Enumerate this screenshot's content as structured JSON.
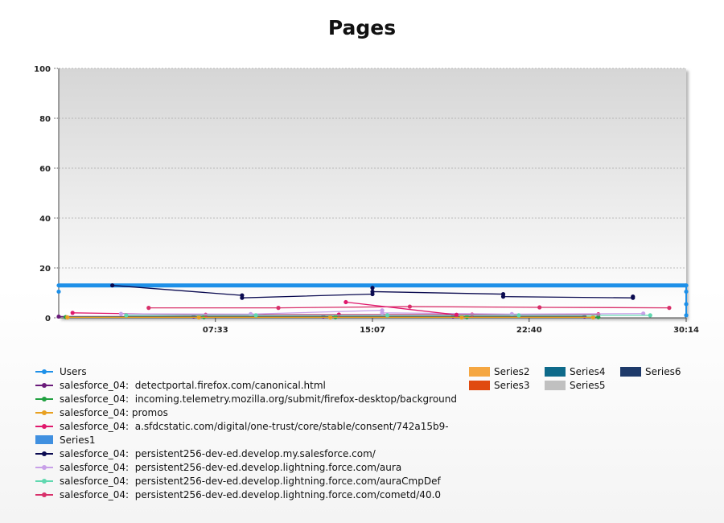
{
  "chart_data": {
    "type": "line",
    "title": "Pages",
    "xlabel": "",
    "ylabel": "",
    "ylim": [
      0,
      100
    ],
    "xlim": [
      "00:00",
      "30:14"
    ],
    "yticks": [
      "0",
      "20",
      "40",
      "60",
      "80",
      "100"
    ],
    "xticks": [
      "07:33",
      "15:07",
      "22:40",
      "30:14"
    ],
    "grid": true,
    "legend_position": "bottom",
    "series": [
      {
        "name": "Users",
        "color": "#1e90e8",
        "marker": "circle",
        "x": [
          "00:00",
          "00:00",
          "30:14",
          "30:14",
          "30:14",
          "30:14"
        ],
        "y": [
          13,
          10.5,
          13,
          10.5,
          5.5,
          1
        ]
      },
      {
        "name": "salesforce_04:  detectportal.firefox.com/canonical.html",
        "color": "#6a1b7a",
        "marker": "circle",
        "x": [
          "00:00",
          "06:30",
          "12:45",
          "19:00",
          "25:20"
        ],
        "y": [
          0.5,
          0.5,
          0.5,
          0.5,
          0.5
        ]
      },
      {
        "name": "salesforce_04:  incoming.telemetry.mozilla.org/submit/firefox-desktop/background",
        "color": "#20a040",
        "marker": "circle",
        "x": [
          "00:20",
          "07:00",
          "13:20",
          "19:40",
          "26:00"
        ],
        "y": [
          0.3,
          0.3,
          0.3,
          0.3,
          0.3
        ]
      },
      {
        "name": "salesforce_04: promos",
        "color": "#e8a020",
        "marker": "circle",
        "x": [
          "00:25",
          "06:45",
          "13:05",
          "19:25",
          "25:45"
        ],
        "y": [
          0.2,
          0.2,
          0.2,
          0.2,
          0.2
        ]
      },
      {
        "name": "salesforce_04:  a.sfdcstatic.com/digital/one-trust/core/stable/consent/742a15b9-",
        "color": "#e0186c",
        "marker": "circle",
        "x": [
          "00:40",
          "07:05",
          "13:30",
          "19:55",
          "26:00"
        ],
        "y": [
          2,
          1.2,
          1.3,
          1.3,
          1.4
        ]
      },
      {
        "name": "Series1",
        "color": "#4090e0",
        "marker": "none",
        "x": [],
        "y": []
      },
      {
        "name": "salesforce_04:  persistent256-dev-ed.develop.my.salesforce.com/",
        "color": "#0a0a50",
        "marker": "circle",
        "x": [
          "02:35",
          "08:50",
          "08:50",
          "15:07",
          "15:07",
          "15:07",
          "21:25",
          "21:25",
          "27:40",
          "27:40"
        ],
        "y": [
          13,
          9,
          8,
          9.5,
          12,
          10.5,
          9.5,
          8.5,
          8,
          8.5
        ]
      },
      {
        "name": "salesforce_04:  persistent256-dev-ed.develop.lightning.force.com/aura",
        "color": "#c8a0e8",
        "marker": "circle",
        "x": [
          "03:00",
          "09:15",
          "15:35",
          "15:35",
          "21:50",
          "28:10"
        ],
        "y": [
          1.6,
          1.5,
          3,
          2,
          1.5,
          1.7
        ]
      },
      {
        "name": "salesforce_04:  persistent256-dev-ed.develop.lightning.force.com/auraCmpDef",
        "color": "#60d8b0",
        "marker": "circle",
        "x": [
          "03:15",
          "09:30",
          "15:50",
          "22:10",
          "28:30"
        ],
        "y": [
          1,
          1,
          1,
          1,
          1
        ]
      },
      {
        "name": "salesforce_04:  persistent256-dev-ed.develop.lightning.force.com/cometd/40.0",
        "color": "#d8306a",
        "marker": "circle",
        "x": [
          "04:20",
          "10:35",
          "16:55",
          "23:10",
          "29:25"
        ],
        "y": [
          4,
          4,
          4.5,
          4.2,
          4
        ]
      },
      {
        "name": "Series2",
        "color": "#f5a742",
        "marker": "none",
        "x": [],
        "y": []
      },
      {
        "name": "Series3",
        "color": "#e04a10",
        "marker": "none",
        "x": [],
        "y": []
      },
      {
        "name": "Series4",
        "color": "#0e6a8a",
        "marker": "none",
        "x": [],
        "y": []
      },
      {
        "name": "Series5",
        "color": "#c0c0c0",
        "marker": "none",
        "x": [],
        "y": []
      },
      {
        "name": "Series6",
        "color": "#1e3a6a",
        "marker": "none",
        "x": [],
        "y": []
      }
    ],
    "extra_lines": [
      {
        "series": "salesforce_04:  a.sfdcstatic.com/digital/one-trust/core/stable/consent/742a15b9-",
        "x": [
          "13:50",
          "19:10"
        ],
        "y": [
          6.3,
          1.2
        ]
      }
    ]
  },
  "colors": {
    "plot_gradient_top": "#d6d6d6",
    "plot_gradient_bottom": "#ffffff"
  }
}
